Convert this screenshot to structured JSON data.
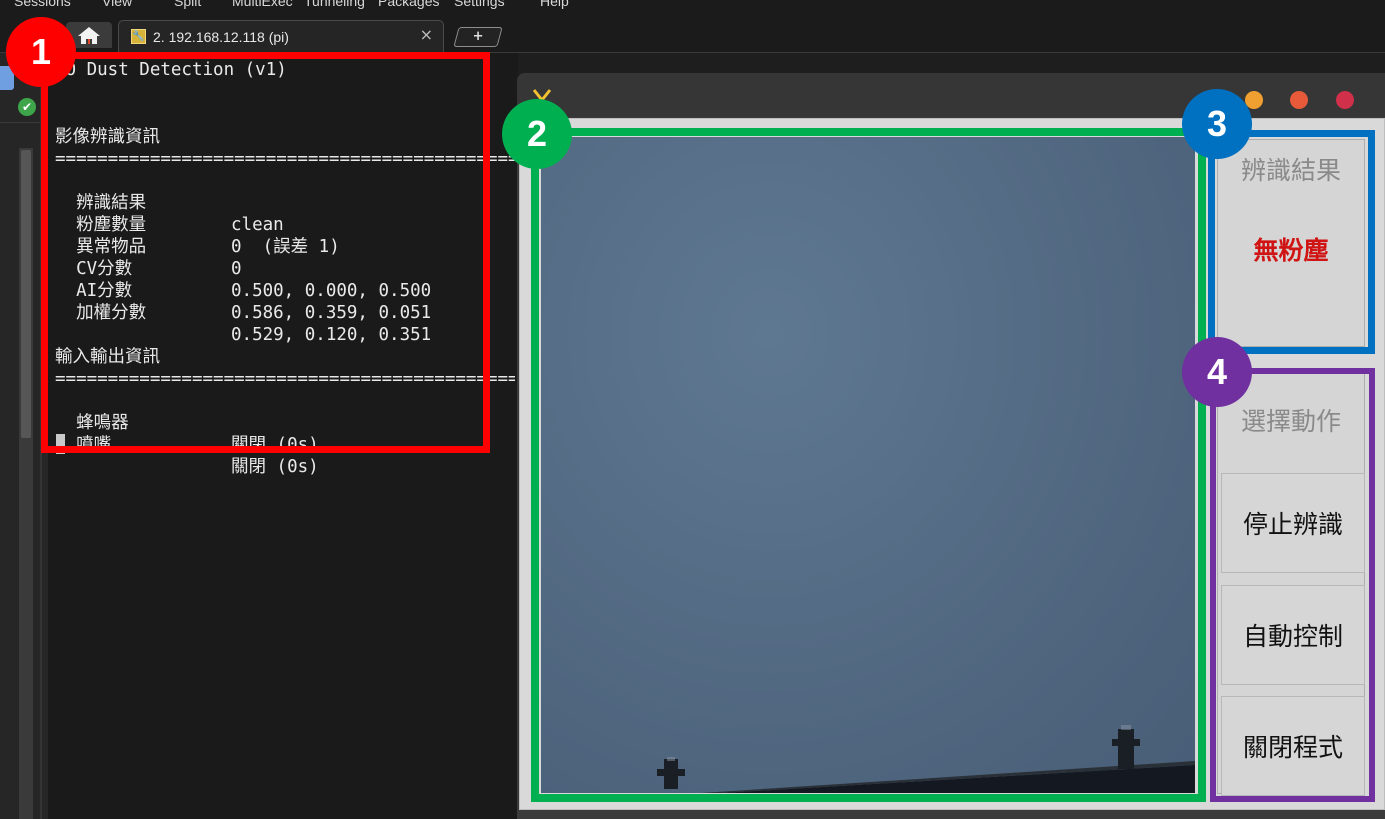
{
  "menubar": {
    "items": [
      "Sessions",
      "View",
      "Split",
      "MultiExec",
      "Tunneling",
      "Packages",
      "Settings",
      "Help"
    ]
  },
  "tabs": {
    "home_icon": "home-icon",
    "session_label": "2. 192.168.12.118 (pi)",
    "close_glyph": "×",
    "new_tab_glyph": "+"
  },
  "terminal": {
    "header": "JO Dust Detection (v1)",
    "section1_title": "影像辨識資訊",
    "separator": "==================================================",
    "rows1": [
      {
        "label": "辨識結果",
        "value": "clean"
      },
      {
        "label": "粉塵數量",
        "value": "0  (誤差 1)"
      },
      {
        "label": "異常物品",
        "value": "0"
      },
      {
        "label": "CV分數",
        "value": "0.500, 0.000, 0.500"
      },
      {
        "label": "AI分數",
        "value": "0.586, 0.359, 0.051"
      },
      {
        "label": "加權分數",
        "value": "0.529, 0.120, 0.351"
      }
    ],
    "section2_title": "輸入輸出資訊",
    "rows2": [
      {
        "label": "蜂鳴器",
        "value": "關閉 (0s)"
      },
      {
        "label": "噴嘴",
        "value": "關閉 (0s)"
      }
    ]
  },
  "app": {
    "result_title": "辨識結果",
    "result_value": "無粉塵",
    "action_title": "選擇動作",
    "buttons": [
      "停止辨識",
      "自動控制",
      "關閉程式"
    ]
  },
  "annotations": [
    {
      "label": "1",
      "color": "#ff0000"
    },
    {
      "label": "2",
      "color": "#00b050"
    },
    {
      "label": "3",
      "color": "#0070c0"
    },
    {
      "label": "4",
      "color": "#7030a0"
    }
  ],
  "colors": {
    "result_text": "#d01414",
    "window_dots": [
      "#f0a030",
      "#e85a3a",
      "#d0304a"
    ]
  }
}
